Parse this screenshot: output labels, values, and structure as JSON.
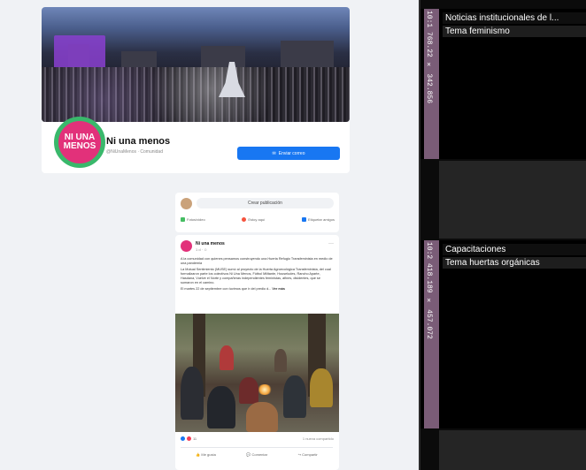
{
  "profile": {
    "name": "Ni una menos",
    "handle": "@NiUnaMenos · Comunidad",
    "avatar_line1": "NI UNA",
    "avatar_line2": "MENOS",
    "send_label": "Enviar correo",
    "next_icon": "›"
  },
  "composer": {
    "button": "Crear publicación",
    "actions": [
      "Fotos/video",
      "Estoy aquí",
      "Etiquetar amigos"
    ]
  },
  "post": {
    "author": "Ni una menos",
    "time": "1 d · ☺",
    "more": "···",
    "text1": "A la comunidad con quienes pensamos construyendo una Huerta Refugio Transfeminista en medio de una pandemia",
    "text2": "La Mutual Sentimiento (MUSE) sumó al proyecto de la Huerta Agroecológica Transfeminista, del cual formalizaron parte los colectivos Ni Una Menos, Fútbol Militante, Houseludes, Rancho Aparte, Hasdana, Vuelve el Norte y compañeras independientes feministas, afines, disidentes, que se sumaron en el camino.",
    "text3": "El martes 22 de septiembre con tuvimos que ir del predio d...",
    "see_more": "Ver más",
    "reactions_count": "11",
    "shares": "1 nueva compartido",
    "actions": [
      "Me gusta",
      "Comentar",
      "Compartir"
    ]
  },
  "panels": [
    {
      "id": "10:1 768.22 × 342.856",
      "title": "Noticias institucionales de l...",
      "tag": "Tema feminismo"
    },
    {
      "id": "10:2 418.189 × 457.072",
      "title": "Capacitaciones",
      "tag": "Tema huertas orgánicas"
    }
  ],
  "colors": {
    "accent_blue": "#1877f2",
    "brand_pink": "#e2317a",
    "brand_green": "#39b86b",
    "panel_stripe": "#7a5c77"
  }
}
